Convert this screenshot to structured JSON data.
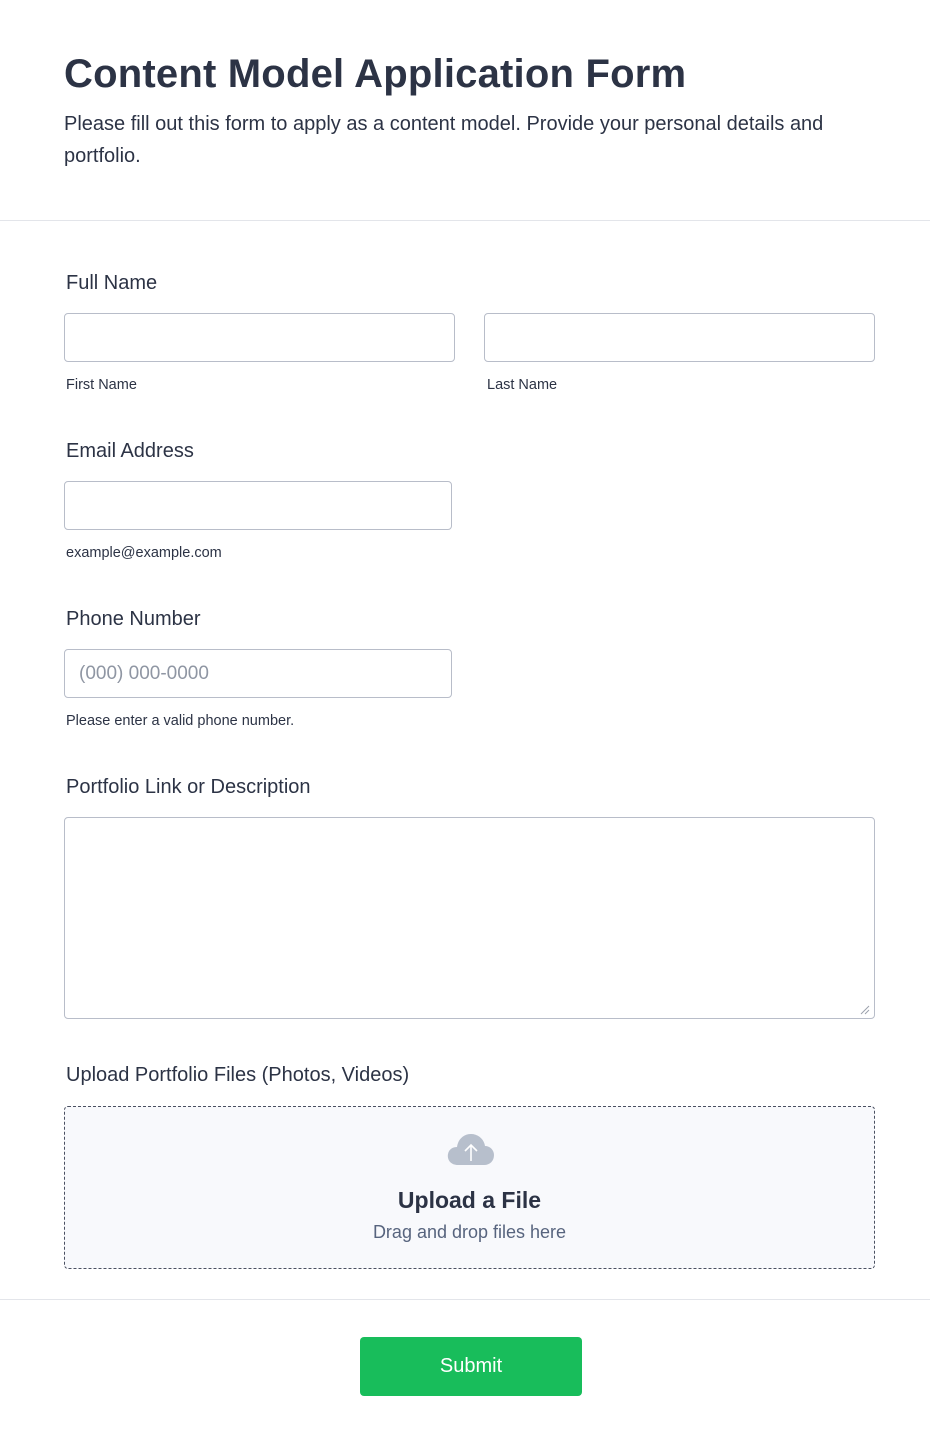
{
  "header": {
    "title": "Content Model Application Form",
    "subtitle": "Please fill out this form to apply as a content model. Provide your personal details and portfolio."
  },
  "full_name": {
    "label": "Full Name",
    "first_value": "",
    "first_sublabel": "First Name",
    "last_value": "",
    "last_sublabel": "Last Name"
  },
  "email": {
    "label": "Email Address",
    "value": "",
    "sublabel": "example@example.com"
  },
  "phone": {
    "label": "Phone Number",
    "value": "",
    "placeholder": "(000) 000-0000",
    "sublabel": "Please enter a valid phone number."
  },
  "portfolio": {
    "label": "Portfolio Link or Description",
    "value": ""
  },
  "upload": {
    "label": "Upload Portfolio Files (Photos, Videos)",
    "title": "Upload a File",
    "subtitle": "Drag and drop files here",
    "icon": "cloud-upload-icon"
  },
  "submit": {
    "label": "Submit",
    "color": "#18bd5b"
  }
}
